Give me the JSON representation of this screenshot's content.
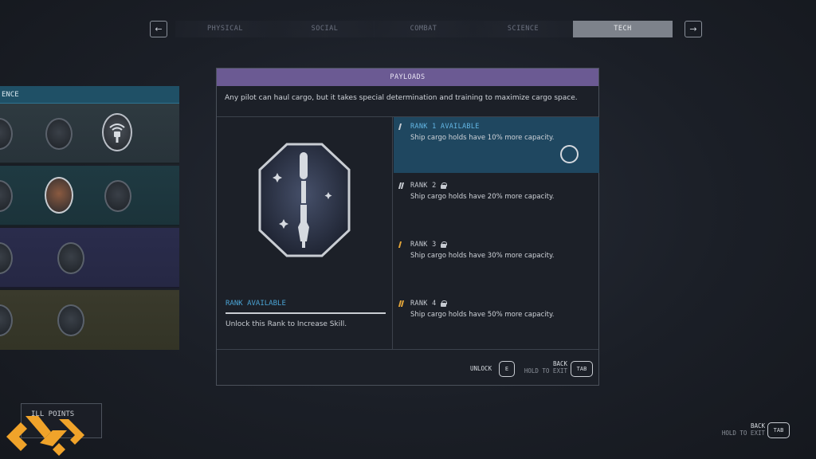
{
  "tabs": {
    "prev_icon": "arrow-left-icon",
    "prev_glyph": "←",
    "next_icon": "arrow-right-icon",
    "next_glyph": "→",
    "items": [
      {
        "label": "PHYSICAL",
        "active": false
      },
      {
        "label": "SOCIAL",
        "active": false
      },
      {
        "label": "COMBAT",
        "active": false
      },
      {
        "label": "SCIENCE",
        "active": false
      },
      {
        "label": "TECH",
        "active": true
      }
    ]
  },
  "tree": {
    "header": "ENCE"
  },
  "panel": {
    "title": "PAYLOADS",
    "description": "Any pilot can haul cargo, but it takes special determination and training to maximize cargo space.",
    "badge_icon": "rocket-badge-icon",
    "rank_status": "RANK AVAILABLE",
    "rank_hint": "Unlock this Rank to Increase Skill.",
    "ranks": [
      {
        "title": "RANK 1 AVAILABLE",
        "desc": "Ship cargo holds have 10% more capacity.",
        "locked": false
      },
      {
        "title": "RANK 2",
        "desc": "Ship cargo holds have 20% more capacity.",
        "locked": true
      },
      {
        "title": "RANK 3",
        "desc": "Ship cargo holds have 30% more capacity.",
        "locked": true
      },
      {
        "title": "RANK 4",
        "desc": "Ship cargo holds have 50% more capacity.",
        "locked": true
      }
    ],
    "footer": {
      "unlock_label": "UNLOCK",
      "unlock_key": "E",
      "back_label": "BACK",
      "back_sub": "HOLD TO EXIT",
      "back_key": "TAB"
    }
  },
  "bottom": {
    "skill_points_label": "ILL POINTS",
    "back_label": "BACK",
    "back_sub": "HOLD TO EXIT",
    "back_key": "TAB"
  },
  "colors": {
    "header_purple": "#6b5a93",
    "selected_rank": "#1f4760",
    "accent_blue": "#4aa3d4",
    "logo_orange": "#f0a32a"
  }
}
